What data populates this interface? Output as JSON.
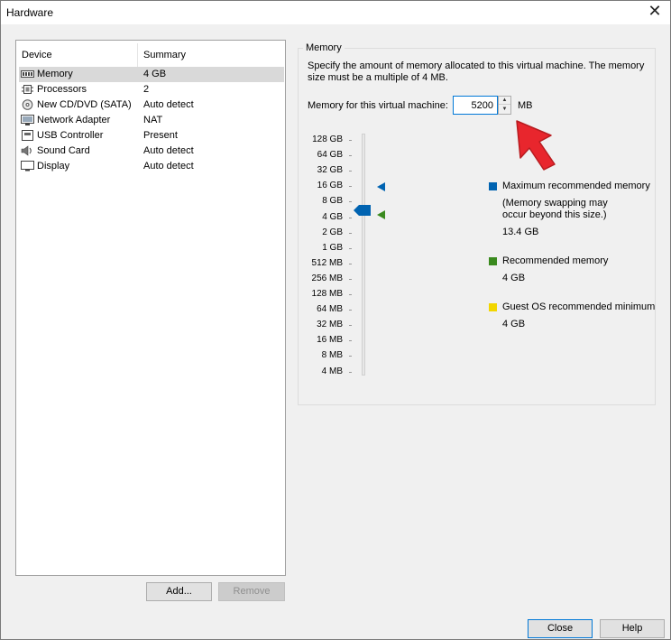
{
  "window": {
    "title": "Hardware",
    "close_glyph": "✕"
  },
  "devices": {
    "col_device": "Device",
    "col_summary": "Summary",
    "rows": [
      {
        "name": "Memory",
        "summary": "4 GB",
        "icon": "memory-icon"
      },
      {
        "name": "Processors",
        "summary": "2",
        "icon": "processor-icon"
      },
      {
        "name": "New CD/DVD (SATA)",
        "summary": "Auto detect",
        "icon": "cd-dvd-icon"
      },
      {
        "name": "Network Adapter",
        "summary": "NAT",
        "icon": "network-adapter-icon"
      },
      {
        "name": "USB Controller",
        "summary": "Present",
        "icon": "usb-icon"
      },
      {
        "name": "Sound Card",
        "summary": "Auto detect",
        "icon": "sound-card-icon"
      },
      {
        "name": "Display",
        "summary": "Auto detect",
        "icon": "display-icon"
      }
    ],
    "selected": "Memory",
    "add_label": "Add...",
    "remove_label": "Remove"
  },
  "memory": {
    "group_label": "Memory",
    "description": "Specify the amount of memory allocated to this virtual machine. The memory size must be a multiple of 4 MB.",
    "field_label": "Memory for this virtual machine:",
    "value": "5200",
    "unit": "MB",
    "scale": [
      "128 GB",
      "64 GB",
      "32 GB",
      "16 GB",
      "8 GB",
      "4 GB",
      "2 GB",
      "1 GB",
      "512 MB",
      "256 MB",
      "128 MB",
      "64 MB",
      "32 MB",
      "16 MB",
      "8 MB",
      "4 MB"
    ],
    "max_recommended": {
      "label": "Maximum recommended memory",
      "note": "(Memory swapping may occur beyond this size.)",
      "value": "13.4 GB",
      "color": "#0063b1"
    },
    "recommended": {
      "label": "Recommended memory",
      "value": "4 GB",
      "color": "#3a8a1e"
    },
    "guest_min": {
      "label": "Guest OS recommended minimum",
      "value": "4 GB",
      "color": "#f2d600"
    }
  },
  "footer": {
    "close_label": "Close",
    "help_label": "Help"
  },
  "annotation": {
    "arrow_color": "#e8262d"
  }
}
